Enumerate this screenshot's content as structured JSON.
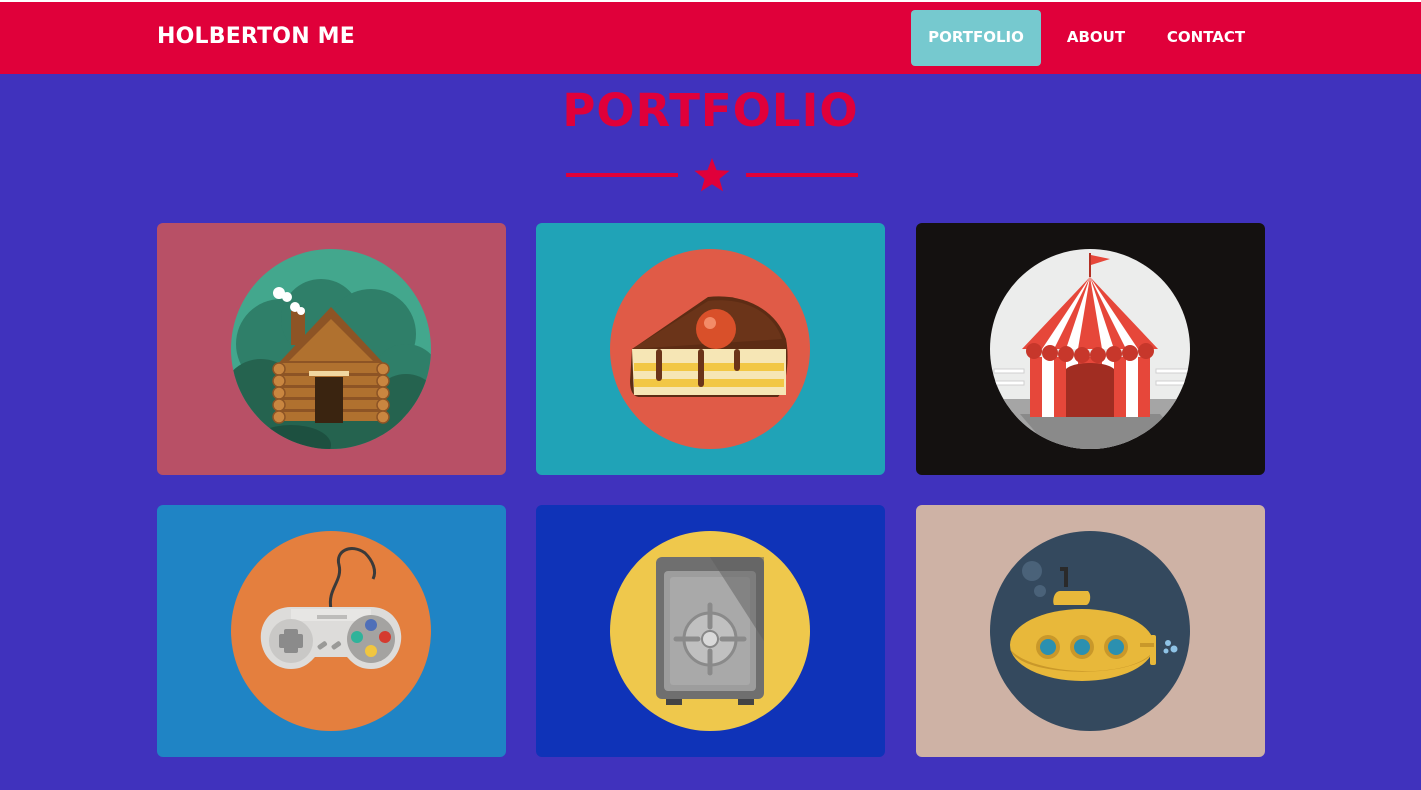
{
  "navbar": {
    "brand": "HOLBERTON ME",
    "items": [
      {
        "label": "PORTFOLIO",
        "active": true
      },
      {
        "label": "ABOUT",
        "active": false
      },
      {
        "label": "CONTACT",
        "active": false
      }
    ]
  },
  "portfolio": {
    "title": "PORTFOLIO",
    "divider_icon": "star-icon",
    "items": [
      {
        "icon": "log-cabin-icon",
        "bg": "#b85066",
        "circle": "#43a78d"
      },
      {
        "icon": "cake-slice-icon",
        "bg": "#20a3b7",
        "circle": "#e05b47"
      },
      {
        "icon": "circus-tent-icon",
        "bg": "#141110",
        "circle": "#ecedec"
      },
      {
        "icon": "game-controller-icon",
        "bg": "#1f84c5",
        "circle": "#e47f3e"
      },
      {
        "icon": "safe-icon",
        "bg": "#0f33b8",
        "circle": "#efc84c"
      },
      {
        "icon": "submarine-icon",
        "bg": "#ceb2a5",
        "circle": "#34495e"
      }
    ]
  },
  "colors": {
    "page_bg": "#4032bd",
    "navbar_bg": "#e0003a",
    "active_nav_bg": "#76c9cf",
    "accent": "#e0003a"
  }
}
